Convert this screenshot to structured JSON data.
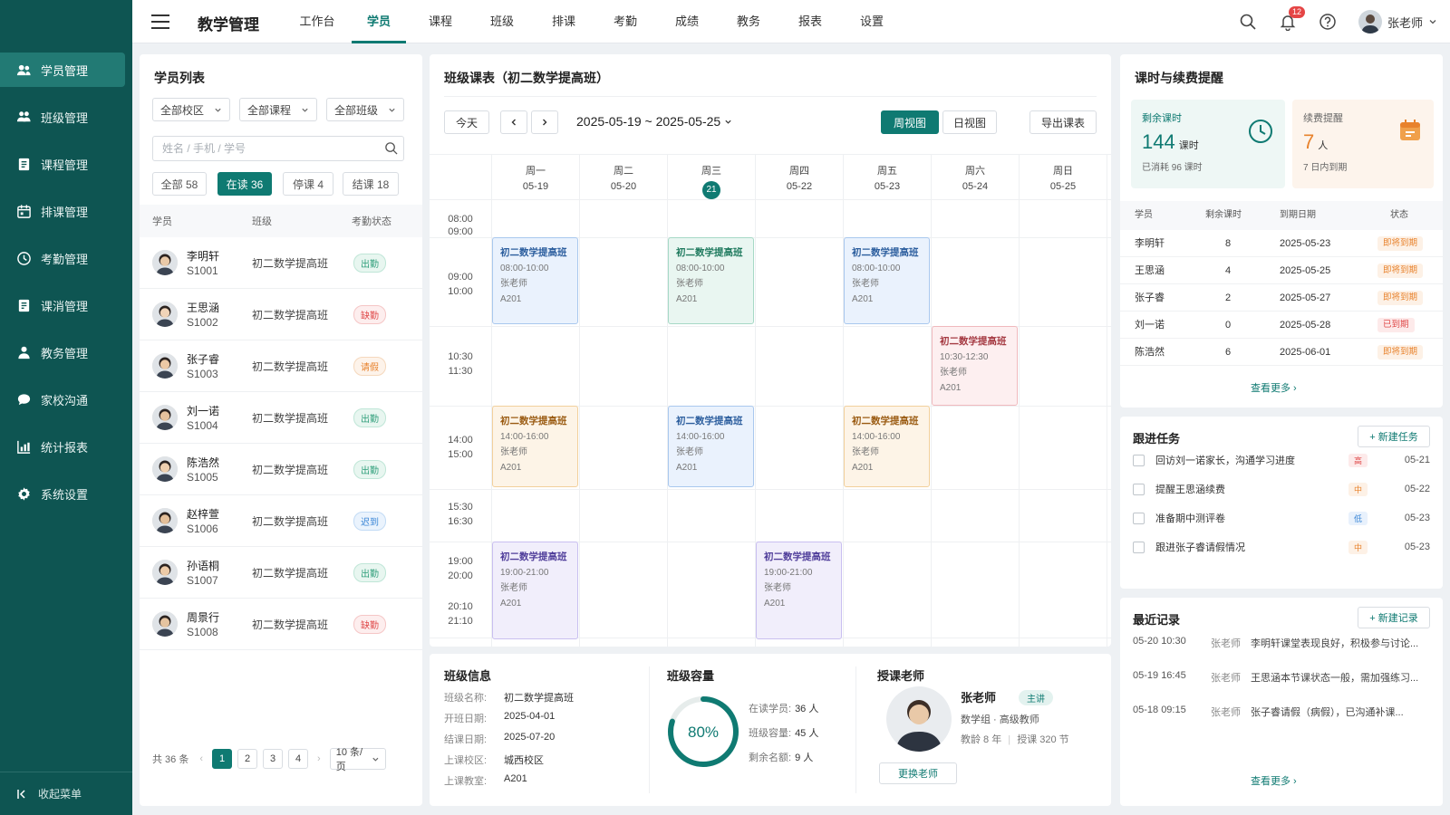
{
  "sidebar": {
    "items": [
      {
        "label": "学员管理",
        "icon": "users-icon"
      },
      {
        "label": "班级管理",
        "icon": "class-icon"
      },
      {
        "label": "课程管理",
        "icon": "book-icon"
      },
      {
        "label": "排课管理",
        "icon": "calendar-icon"
      },
      {
        "label": "考勤管理",
        "icon": "clock-icon"
      },
      {
        "label": "课消管理",
        "icon": "receipt-icon"
      },
      {
        "label": "教务管理",
        "icon": "staff-icon"
      },
      {
        "label": "家校沟通",
        "icon": "chat-icon"
      },
      {
        "label": "统计报表",
        "icon": "chart-icon"
      },
      {
        "label": "系统设置",
        "icon": "gear-icon"
      }
    ],
    "collapse": "收起菜单"
  },
  "header": {
    "title": "教学管理",
    "tabs": [
      "工作台",
      "学员",
      "课程",
      "班级",
      "排课",
      "考勤",
      "成绩",
      "教务",
      "报表",
      "设置"
    ],
    "active_tab": 1,
    "notif_count": "12",
    "user": "张老师"
  },
  "students": {
    "title": "学员列表",
    "filters": [
      "全部校区",
      "全部课程",
      "全部班级"
    ],
    "search_placeholder": "姓名 / 手机 / 学号",
    "tabs": [
      {
        "label": "全部 58"
      },
      {
        "label": "在读 36"
      },
      {
        "label": "停课 4"
      },
      {
        "label": "结课 18"
      }
    ],
    "columns": [
      "学员",
      "班级",
      "考勤状态"
    ],
    "rows": [
      {
        "name": "李明轩",
        "id": "S1001",
        "class": "初二数学提高班",
        "status": "出勤",
        "type": "ok"
      },
      {
        "name": "王思涵",
        "id": "S1002",
        "class": "初二数学提高班",
        "status": "缺勤",
        "type": "bad"
      },
      {
        "name": "张子睿",
        "id": "S1003",
        "class": "初二数学提高班",
        "status": "请假",
        "type": "leave"
      },
      {
        "name": "刘一诺",
        "id": "S1004",
        "class": "初二数学提高班",
        "status": "出勤",
        "type": "ok"
      },
      {
        "name": "陈浩然",
        "id": "S1005",
        "class": "初二数学提高班",
        "status": "出勤",
        "type": "ok"
      },
      {
        "name": "赵梓萱",
        "id": "S1006",
        "class": "初二数学提高班",
        "status": "迟到",
        "type": "late"
      },
      {
        "name": "孙语桐",
        "id": "S1007",
        "class": "初二数学提高班",
        "status": "出勤",
        "type": "ok"
      },
      {
        "name": "周景行",
        "id": "S1008",
        "class": "初二数学提高班",
        "status": "缺勤",
        "type": "bad"
      }
    ],
    "pager": {
      "total": "共 36 条",
      "pages": [
        "1",
        "2",
        "3",
        "4"
      ],
      "page_size": "10 条/页"
    }
  },
  "schedule": {
    "title": "班级课表（初二数学提高班）",
    "today_btn": "今天",
    "range": "2025-05-19 ~ 2025-05-25",
    "views": [
      "周视图",
      "日视图"
    ],
    "export": "导出课表",
    "days": [
      {
        "wk": "周一",
        "date": "05-19"
      },
      {
        "wk": "周二",
        "date": "05-20"
      },
      {
        "wk": "周三",
        "date": "21",
        "today": true
      },
      {
        "wk": "周四",
        "date": "05-22"
      },
      {
        "wk": "周五",
        "date": "05-23"
      },
      {
        "wk": "周六",
        "date": "05-24"
      },
      {
        "wk": "周日",
        "date": "05-25"
      }
    ],
    "times": [
      "08:00",
      "09:00",
      "09:00",
      "10:00",
      "10:30",
      "11:30",
      "14:00",
      "15:00",
      "15:30",
      "16:30",
      "19:00",
      "20:00",
      "20:10",
      "21:10"
    ],
    "courses": [
      {
        "day": 0,
        "slot": 0,
        "name": "初二数学提高班",
        "time": "08:00-10:00",
        "teacher": "张老师",
        "room": "A201",
        "color": "blue"
      },
      {
        "day": 2,
        "slot": 0,
        "name": "初二数学提高班",
        "time": "08:00-10:00",
        "teacher": "张老师",
        "room": "A201",
        "color": "green"
      },
      {
        "day": 4,
        "slot": 0,
        "name": "初二数学提高班",
        "time": "08:00-10:00",
        "teacher": "张老师",
        "room": "A201",
        "color": "blue"
      },
      {
        "day": 5,
        "slot": 1,
        "name": "初二数学提高班",
        "time": "10:30-12:30",
        "teacher": "张老师",
        "room": "A201",
        "color": "red"
      },
      {
        "day": 0,
        "slot": 2,
        "name": "初二数学提高班",
        "time": "14:00-16:00",
        "teacher": "张老师",
        "room": "A201",
        "color": "orange"
      },
      {
        "day": 2,
        "slot": 2,
        "name": "初二数学提高班",
        "time": "14:00-16:00",
        "teacher": "张老师",
        "room": "A201",
        "color": "blue"
      },
      {
        "day": 4,
        "slot": 2,
        "name": "初二数学提高班",
        "time": "14:00-16:00",
        "teacher": "张老师",
        "room": "A201",
        "color": "orange"
      },
      {
        "day": 0,
        "slot": 4,
        "name": "初二数学提高班",
        "time": "19:00-21:00",
        "teacher": "张老师",
        "room": "A201",
        "color": "purple"
      },
      {
        "day": 3,
        "slot": 4,
        "name": "初二数学提高班",
        "time": "19:00-21:00",
        "teacher": "张老师",
        "room": "A201",
        "color": "purple"
      }
    ]
  },
  "class_info": {
    "title": "班级信息",
    "rows": [
      {
        "k": "班级名称:",
        "v": "初二数学提高班"
      },
      {
        "k": "开班日期:",
        "v": "2025-04-01"
      },
      {
        "k": "结课日期:",
        "v": "2025-07-20"
      },
      {
        "k": "上课校区:",
        "v": "城西校区"
      },
      {
        "k": "上课教室:",
        "v": "A201"
      }
    ]
  },
  "capacity": {
    "title": "班级容量",
    "percent": "80%",
    "fraction": 0.8,
    "rows": [
      {
        "k": "在读学员:",
        "v": "36 人"
      },
      {
        "k": "班级容量:",
        "v": "45 人"
      },
      {
        "k": "剩余名额:",
        "v": "9 人"
      }
    ]
  },
  "teacher": {
    "title": "授课老师",
    "name": "张老师",
    "badge": "主讲",
    "role": "数学组 · 高级教师",
    "exp": "教龄 8 年",
    "lessons": "授课 320 节",
    "btn": "更换老师"
  },
  "hours": {
    "title": "课时与续费提醒",
    "remain_label": "剩余课时",
    "remain_value": "144",
    "remain_unit": "课时",
    "remain_sub": "已消耗 96 课时",
    "renew_label": "续费提醒",
    "renew_value": "7",
    "renew_unit": "人",
    "renew_sub": "7 日内到期",
    "columns": [
      "学员",
      "剩余课时",
      "到期日期",
      "状态"
    ],
    "rows": [
      {
        "name": "李明轩",
        "left": "8",
        "date": "2025-05-23",
        "status": "即将到期",
        "type": "soon"
      },
      {
        "name": "王思涵",
        "left": "4",
        "date": "2025-05-25",
        "status": "即将到期",
        "type": "soon"
      },
      {
        "name": "张子睿",
        "left": "2",
        "date": "2025-05-27",
        "status": "即将到期",
        "type": "soon"
      },
      {
        "name": "刘一诺",
        "left": "0",
        "date": "2025-05-28",
        "status": "已到期",
        "type": "expired"
      },
      {
        "name": "陈浩然",
        "left": "6",
        "date": "2025-06-01",
        "status": "即将到期",
        "type": "soon"
      }
    ],
    "more": "查看更多 ›"
  },
  "tasks": {
    "title": "跟进任务",
    "add": "+ 新建任务",
    "items": [
      {
        "text": "回访刘一诺家长，沟通学习进度",
        "prio": "高",
        "type": "high",
        "date": "05-21"
      },
      {
        "text": "提醒王思涵续费",
        "prio": "中",
        "type": "mid",
        "date": "05-22"
      },
      {
        "text": "准备期中测评卷",
        "prio": "低",
        "type": "low",
        "date": "05-23"
      },
      {
        "text": "跟进张子睿请假情况",
        "prio": "中",
        "type": "mid",
        "date": "05-23"
      }
    ]
  },
  "records": {
    "title": "最近记录",
    "add": "+ 新建记录",
    "items": [
      {
        "time": "05-20 10:30",
        "who": "张老师",
        "text": "李明轩课堂表现良好，积极参与讨论..."
      },
      {
        "time": "05-19 16:45",
        "who": "张老师",
        "text": "王思涵本节课状态一般，需加强练习..."
      },
      {
        "time": "05-18 09:15",
        "who": "张老师",
        "text": "张子睿请假（病假），已沟通补课..."
      }
    ],
    "more": "查看更多 ›"
  }
}
